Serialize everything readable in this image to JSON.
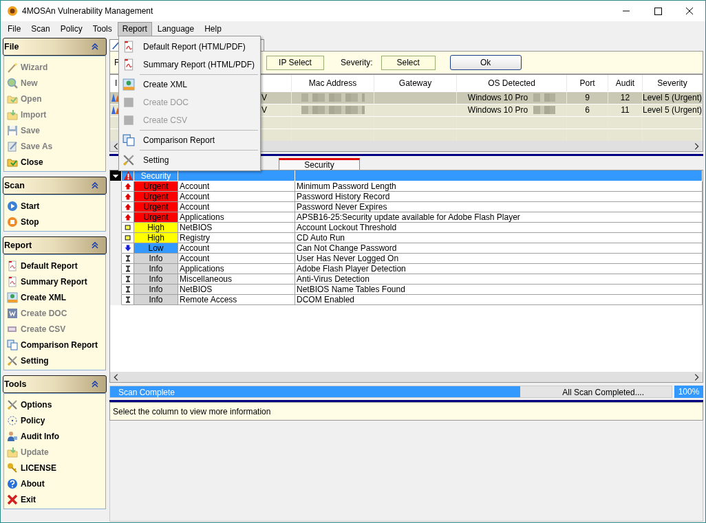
{
  "window": {
    "title": "4MOSAn Vulnerability Management"
  },
  "menubar": [
    {
      "label": "File",
      "selected": false
    },
    {
      "label": "Scan",
      "selected": false
    },
    {
      "label": "Policy",
      "selected": false
    },
    {
      "label": "Tools",
      "selected": false
    },
    {
      "label": "Report",
      "selected": true
    },
    {
      "label": "Language",
      "selected": false
    },
    {
      "label": "Help",
      "selected": false
    }
  ],
  "report_menu": [
    {
      "kind": "item",
      "label": "Default Report (HTML/PDF)",
      "disabled": false
    },
    {
      "kind": "item",
      "label": "Summary Report (HTML/PDF)",
      "disabled": false
    },
    {
      "kind": "separator"
    },
    {
      "kind": "item",
      "label": "Create XML",
      "disabled": false
    },
    {
      "kind": "item",
      "label": "Create DOC",
      "disabled": true
    },
    {
      "kind": "item",
      "label": "Create CSV",
      "disabled": true
    },
    {
      "kind": "separator"
    },
    {
      "kind": "item",
      "label": "Comparison Report",
      "disabled": false
    },
    {
      "kind": "separator"
    },
    {
      "kind": "item",
      "label": "Setting",
      "disabled": false
    }
  ],
  "sidebar": [
    {
      "title": "File",
      "expanded": true,
      "items": [
        {
          "label": "Wizard",
          "disabled": true
        },
        {
          "label": "New",
          "disabled": true
        },
        {
          "label": "Open",
          "disabled": true
        },
        {
          "label": "Import",
          "disabled": true
        },
        {
          "label": "Save",
          "disabled": true
        },
        {
          "label": "Save As",
          "disabled": true
        },
        {
          "label": "Close",
          "disabled": false
        }
      ]
    },
    {
      "title": "Scan",
      "expanded": true,
      "items": [
        {
          "label": "Start",
          "disabled": false
        },
        {
          "label": "Stop",
          "disabled": false
        }
      ]
    },
    {
      "title": "Report",
      "expanded": true,
      "items": [
        {
          "label": "Default Report",
          "disabled": false
        },
        {
          "label": "Summary Report",
          "disabled": false
        },
        {
          "label": "Create XML",
          "disabled": false
        },
        {
          "label": "Create DOC",
          "disabled": true
        },
        {
          "label": "Create CSV",
          "disabled": true
        },
        {
          "label": "Comparison Report",
          "disabled": false
        },
        {
          "label": "Setting",
          "disabled": false
        }
      ]
    },
    {
      "title": "Tools",
      "expanded": true,
      "items": [
        {
          "label": "Options",
          "disabled": false
        },
        {
          "label": "Policy",
          "disabled": false
        },
        {
          "label": "Audit Info",
          "disabled": false
        },
        {
          "label": "Update",
          "disabled": true
        },
        {
          "label": "LICENSE",
          "disabled": false
        },
        {
          "label": "About",
          "disabled": false
        },
        {
          "label": "Exit",
          "disabled": false
        }
      ]
    }
  ],
  "filter_bar": {
    "label": "F",
    "ip_button": "IP Select",
    "severity_label": "Severity:",
    "severity_button": "Select",
    "ok_button": "Ok"
  },
  "hosts_table": {
    "columns": {
      "column_1": "I",
      "mac": "Mac Address",
      "gateway": "Gateway",
      "os": "OS Detected",
      "port": "Port",
      "audit": "Audit",
      "severity": "Severity"
    },
    "rows": [
      {
        "column_2": "V",
        "os": "Windows 10 Pro",
        "port": "9",
        "audit": "12",
        "severity": "Level 5 (Urgent)",
        "selected": true
      },
      {
        "column_2": "V",
        "os": "Windows 10 Pro",
        "port": "6",
        "audit": "11",
        "severity": "Level 5 (Urgent)",
        "selected": false
      }
    ]
  },
  "issue_tabs": [
    {
      "label": "Security",
      "selected": true
    }
  ],
  "issues": {
    "header": "Security",
    "rows": [
      {
        "kind": "urgent",
        "severity": "Urgent",
        "category": "Account",
        "description": "Minimum Password Length"
      },
      {
        "kind": "urgent",
        "severity": "Urgent",
        "category": "Account",
        "description": "Password History Record"
      },
      {
        "kind": "urgent",
        "severity": "Urgent",
        "category": "Account",
        "description": "Password Never Expires"
      },
      {
        "kind": "urgent",
        "severity": "Urgent",
        "category": "Applications",
        "description": "APSB16-25:Security update available for Adobe Flash Player"
      },
      {
        "kind": "high",
        "severity": "High",
        "category": "NetBIOS",
        "description": "Account Lockout Threshold"
      },
      {
        "kind": "high",
        "severity": "High",
        "category": "Registry",
        "description": "CD Auto Run"
      },
      {
        "kind": "low",
        "severity": "Low",
        "category": "Account",
        "description": "Can Not Change Password"
      },
      {
        "kind": "info",
        "severity": "Info",
        "category": "Account",
        "description": "User Has Never Logged On"
      },
      {
        "kind": "info",
        "severity": "Info",
        "category": "Applications",
        "description": "Adobe Flash Player Detection"
      },
      {
        "kind": "info",
        "severity": "Info",
        "category": "Miscellaneous",
        "description": "Anti-Virus Detection"
      },
      {
        "kind": "info",
        "severity": "Info",
        "category": "NetBIOS",
        "description": "NetBIOS Name Tables Found"
      },
      {
        "kind": "info",
        "severity": "Info",
        "category": "Remote Access",
        "description": "DCOM Enabled"
      }
    ]
  },
  "status": {
    "message": "Scan Complete",
    "level": 0.73,
    "summary": "All Scan Completed....",
    "percent": "100%"
  },
  "info_panel": {
    "text": "Select the column to view more information"
  }
}
